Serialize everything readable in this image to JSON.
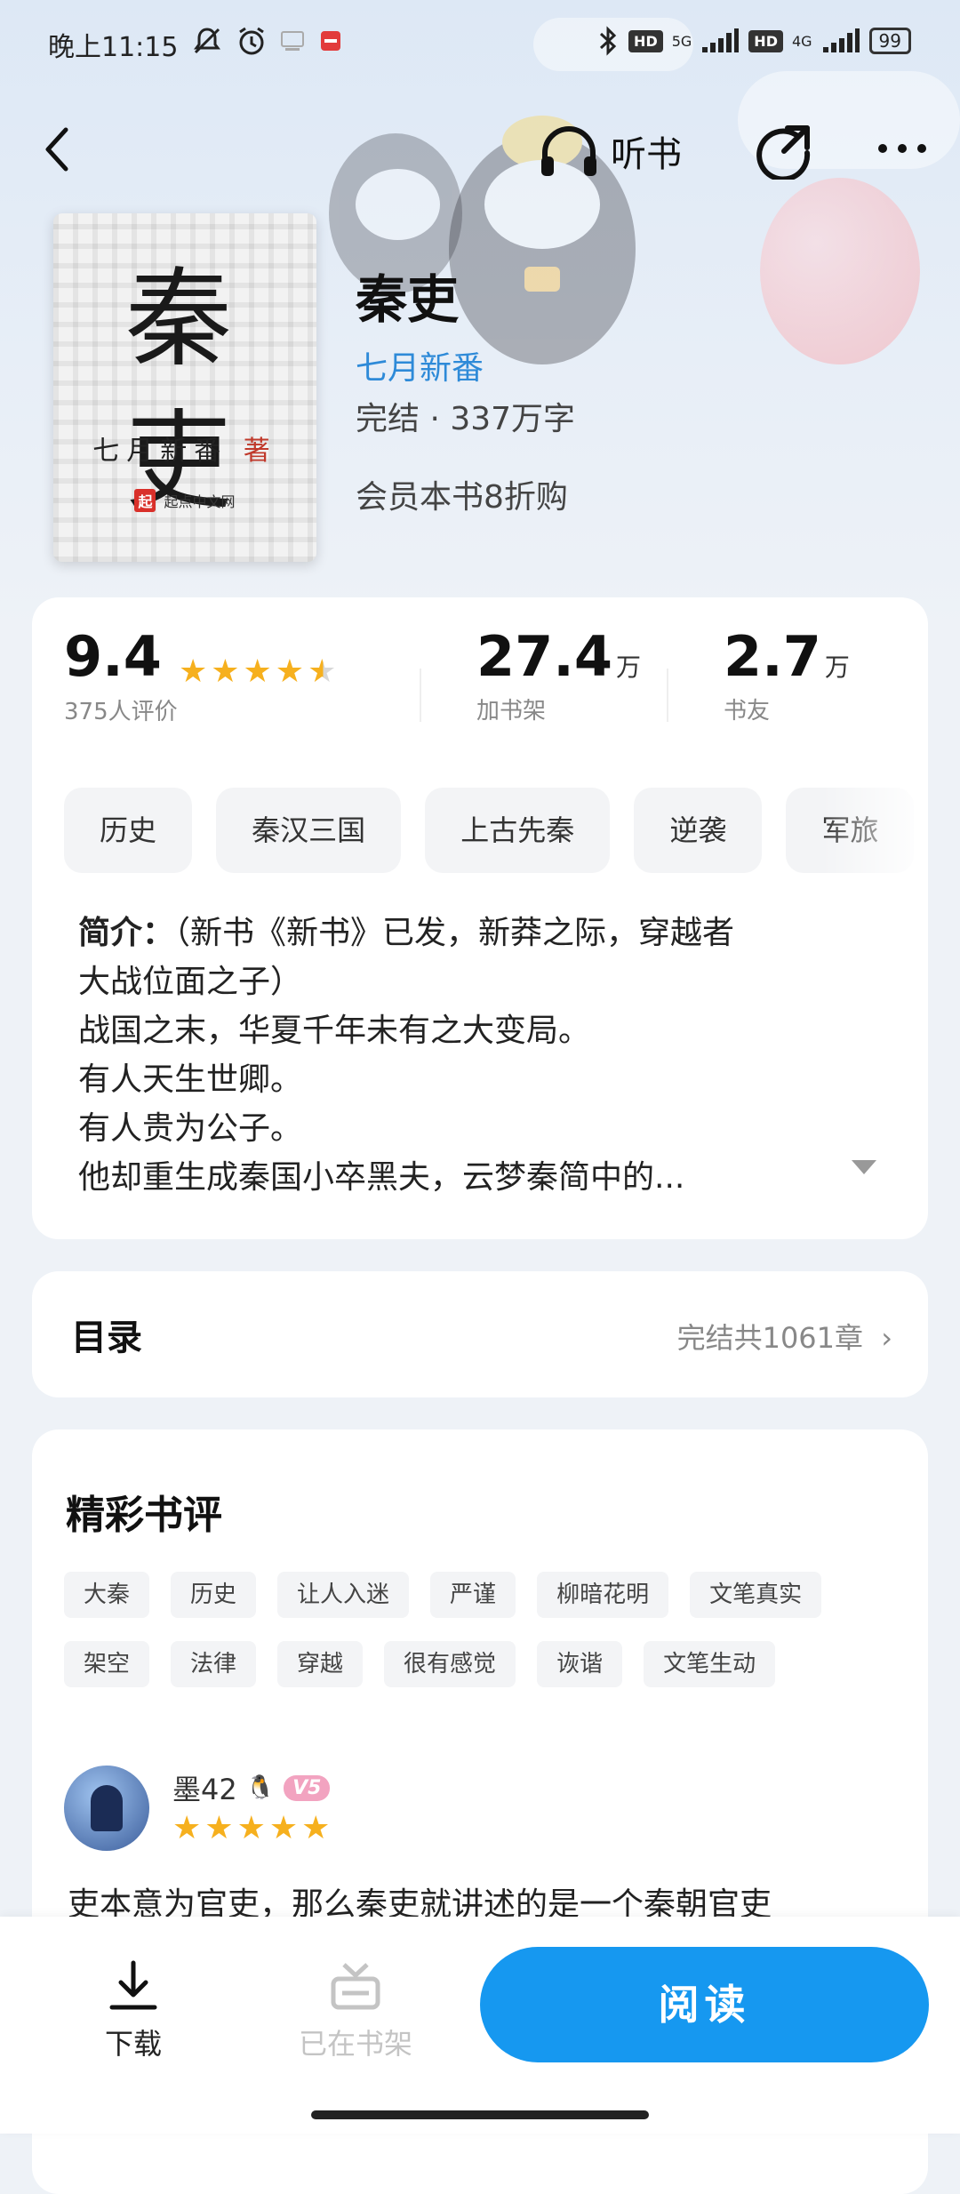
{
  "status_bar": {
    "time": "晚上11:15",
    "battery": "99",
    "network_1": "5G",
    "network_2": "4G",
    "hd_1": "HD",
    "hd_2": "HD"
  },
  "nav": {
    "listen_label": "听书"
  },
  "book": {
    "cover_title": "秦吏",
    "cover_author": "七月新番",
    "cover_author_suffix": "著",
    "cover_publisher": "起点中文网",
    "title": "秦吏",
    "author": "七月新番",
    "status_words": "完结 · 337万字",
    "promo": "会员本书8折购"
  },
  "stats": {
    "rating": "9.4",
    "rating_count": "375人评价",
    "shelf_num": "27.4",
    "shelf_unit": "万",
    "shelf_label": "加书架",
    "fans_num": "2.7",
    "fans_unit": "万",
    "fans_label": "书友",
    "star_fraction": 0.9
  },
  "tags": [
    "历史",
    "秦汉三国",
    "上古先秦",
    "逆袭",
    "军旅"
  ],
  "intro": {
    "heading": "简介：",
    "line1": "（新书《新书》已发，新莽之际，穿越者",
    "line2": "大战位面之子）",
    "line3": "战国之末，华夏千年未有之大变局。",
    "line4": "有人天生世卿。",
    "line5": "有人贵为公子。",
    "line6": "他却重生成秦国小卒黑夫，云梦秦简中的..."
  },
  "toc": {
    "title": "目录",
    "info": "完结共1061章"
  },
  "reviews": {
    "title": "精彩书评",
    "tags": [
      "大秦",
      "历史",
      "让人入迷",
      "严谨",
      "柳暗花明",
      "文笔真实",
      "架空",
      "法律",
      "穿越",
      "很有感觉",
      "诙谐",
      "文笔生动"
    ],
    "user": "墨42",
    "badge": "V5",
    "stars": 5,
    "text": "吏本意为官吏，那么秦吏就讲述的是一个秦朝官吏"
  },
  "bottom": {
    "download_label": "下载",
    "shelf_label": "已在书架",
    "read_label": "阅读"
  },
  "colors": {
    "accent": "#1698f0",
    "author_link": "#2e8ad8",
    "star": "#f6b01e"
  }
}
